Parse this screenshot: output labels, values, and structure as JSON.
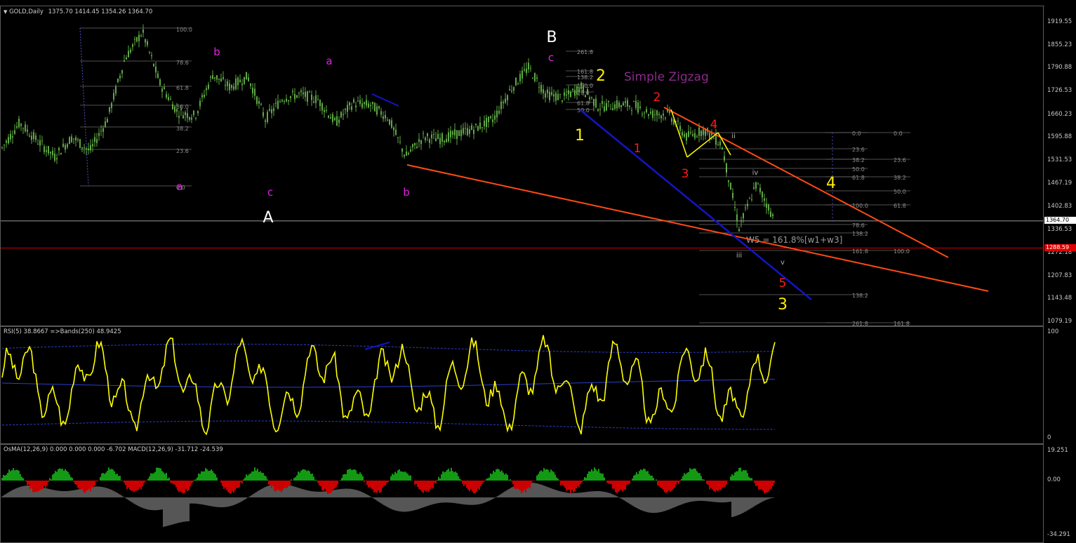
{
  "header": {
    "symbol_label": "GOLD,Daily",
    "ohlc_label": "1375.70 1414.45 1354.26 1364.70"
  },
  "price_scale": [
    "1919.55",
    "1855.23",
    "1790.88",
    "1726.53",
    "1660.23",
    "1595.88",
    "1531.53",
    "1467.19",
    "1402.83",
    "1336.53",
    "1272.18",
    "1207.83",
    "1143.48",
    "1079.19"
  ],
  "current_price": "1364.70",
  "red_price": "1288.59",
  "wave_labels": {
    "pink": [
      "b",
      "a",
      "a",
      "c",
      "b",
      "c"
    ],
    "white": [
      "B",
      "A"
    ],
    "yellow": [
      "2",
      "1",
      "4",
      "3"
    ],
    "red": [
      "2",
      "1",
      "4",
      "3",
      "5"
    ],
    "small": [
      "ii",
      "i",
      "iv",
      "iii",
      "v"
    ],
    "title": "Simple Zigzag",
    "target_note": "W5 = 161.8%[w1+w3]"
  },
  "fib_left": [
    "100.0",
    "78.6",
    "61.8",
    "50.0",
    "38.2",
    "23.6",
    "0.0"
  ],
  "fib_top": [
    "261.8",
    "161.8",
    "138.2",
    "100.0",
    "78.6",
    "61.8",
    "50.0"
  ],
  "fib_right_col1": [
    "0.0",
    "23.6",
    "38.2",
    "50.0",
    "61.8",
    "100.0",
    "78.6",
    "138.2",
    "161.8",
    "138.2",
    "261.8"
  ],
  "fib_right_col2": [
    "0.0",
    "23.6",
    "38.2",
    "50.0",
    "61.8",
    "100.0",
    "161.8"
  ],
  "rsi": {
    "label": "RSI(5) 38.8667 =>Bands(250) 48.9425",
    "scale_top": "100",
    "scale_bottom": "0"
  },
  "macd": {
    "label": "OsMA(12,26,9) 0.000 0.000 0.000 -6.702 MACD(12,26,9) -31.712 -24.539",
    "scale_top": "19.251",
    "scale_mid": "0.00",
    "scale_bottom": "-34.291"
  },
  "colors": {
    "candle": "#5fa845",
    "rsi_line": "#ffff00",
    "rsi_band": "#2a3fd0",
    "trend_red": "#ff4a14",
    "trend_blue": "#1414c8",
    "osma_up": "#19c019",
    "osma_down": "#ff0000",
    "macd_bar": "#d8d8d8"
  },
  "chart_data": {
    "type": "line",
    "title": "GOLD,Daily",
    "xlabel": "",
    "ylabel": "",
    "ylim": [
      1079.19,
      1919.55
    ],
    "x": [
      0,
      25,
      50,
      75,
      100,
      125,
      150,
      175,
      200,
      225,
      250,
      275,
      300,
      325,
      350,
      375,
      400,
      425,
      450,
      475,
      500,
      525,
      550,
      575,
      600,
      625,
      650,
      675,
      700,
      725,
      750,
      775,
      800,
      825,
      850,
      875,
      900,
      925,
      950,
      975,
      1000,
      1025,
      1050,
      1075,
      1100
    ],
    "series": [
      {
        "name": "GOLD,Daily",
        "values": [
          1570,
          1640,
          1590,
          1545,
          1600,
          1560,
          1650,
          1820,
          1895,
          1750,
          1670,
          1660,
          1775,
          1740,
          1770,
          1650,
          1710,
          1720,
          1705,
          1640,
          1695,
          1690,
          1655,
          1545,
          1600,
          1595,
          1610,
          1625,
          1650,
          1735,
          1795,
          1720,
          1710,
          1740,
          1685,
          1690,
          1690,
          1665,
          1665,
          1600,
          1620,
          1580,
          1345,
          1470,
          1370
        ]
      }
    ]
  }
}
